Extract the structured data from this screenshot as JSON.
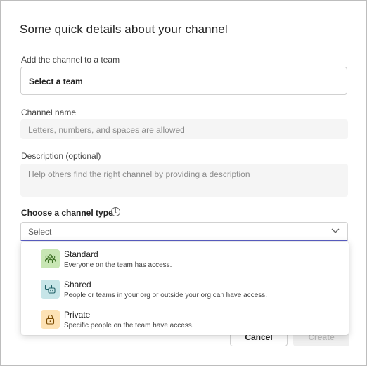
{
  "dialog": {
    "title": "Some quick details about your channel"
  },
  "team": {
    "label": "Add the channel to a team",
    "value": "Select a team"
  },
  "channel_name": {
    "label": "Channel name",
    "placeholder": "Letters, numbers, and spaces are allowed"
  },
  "description": {
    "label": "Description (optional)",
    "placeholder": "Help others find the right channel by providing a description"
  },
  "channel_type": {
    "label": "Choose a channel type",
    "info_icon": "i",
    "value": "Select",
    "options": [
      {
        "name": "Standard",
        "description": "Everyone on the team has access.",
        "icon": "people-icon",
        "icon_bg": "#c8e6b4"
      },
      {
        "name": "Shared",
        "description": "People or teams in your org or outside your org can have access.",
        "icon": "shared-chat-icon",
        "icon_bg": "#c7e5e8"
      },
      {
        "name": "Private",
        "description": "Specific people on the team have access.",
        "icon": "lock-icon",
        "icon_bg": "#fde2b5"
      }
    ]
  },
  "footer": {
    "cancel_label": "Cancel",
    "create_label": "Create"
  },
  "colors": {
    "accent": "#5b5fc7",
    "input_fill": "#f5f5f5"
  }
}
